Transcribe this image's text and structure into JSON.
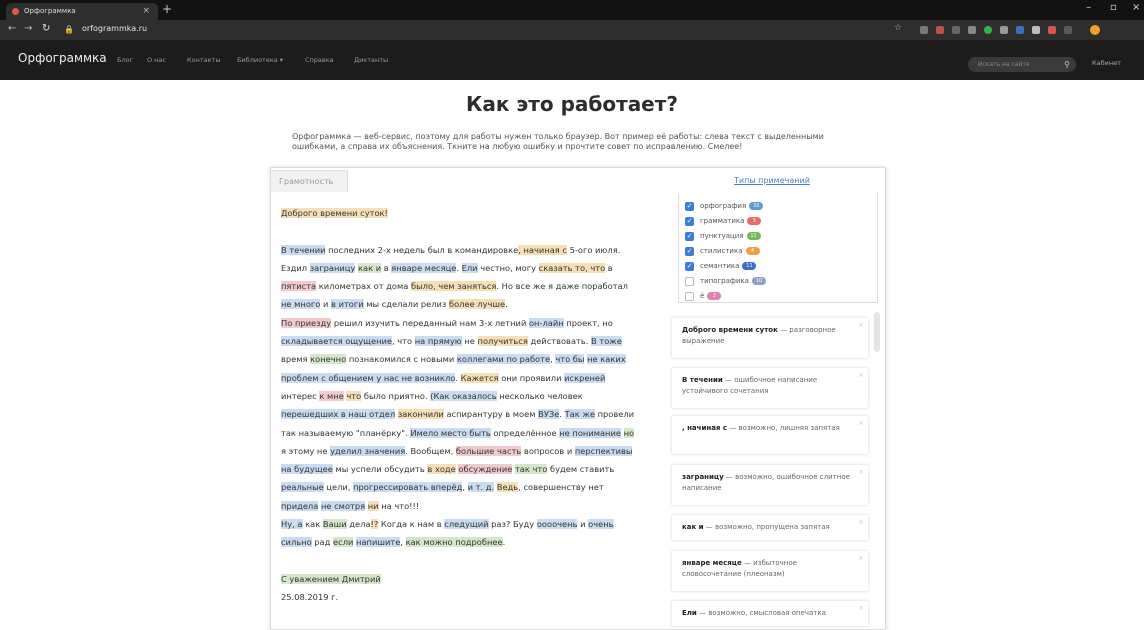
{
  "browser": {
    "tab_title": "Орфограммка",
    "url": "orfogrammka.ru"
  },
  "site": {
    "brand": "Орфограммка",
    "menu": [
      "Блог",
      "О нас",
      "Контакты",
      "Библиотека ▾",
      "Справка",
      "Диктанты"
    ],
    "search_placeholder": "Искать на сайте",
    "cabinet": "Кабинет"
  },
  "page": {
    "title": "Как это работает?",
    "intro": "Орфограммка — веб-сервис, поэтому для работы нужен только браузер. Вот пример её работы: слева текст с выделенными ошибками, а справа их объяснения. Ткните на любую ошибку и прочтите совет по исправлению. Смелее!",
    "tab_label": "Грамотность",
    "types_link": "Типы примечаний"
  },
  "text_lines": [
    [
      [
        "Доброго времени суток!",
        "p"
      ]
    ],
    [],
    [
      [
        "В течении",
        "o"
      ],
      [
        " последних 2-х недель был в командировке",
        ""
      ],
      [
        ", начиная с",
        "p"
      ],
      [
        " 5-ого июля.",
        ""
      ]
    ],
    [
      [
        "Ездил ",
        ""
      ],
      [
        "заграницу",
        "o"
      ],
      [
        " ",
        ""
      ],
      [
        "как и",
        "s"
      ],
      [
        " в ",
        ""
      ],
      [
        "январе месяце",
        "o"
      ],
      [
        ". ",
        ""
      ],
      [
        "Ели",
        "o"
      ],
      [
        " честно, могу ",
        ""
      ],
      [
        "сказать то, что",
        "p"
      ],
      [
        " в",
        ""
      ]
    ],
    [
      [
        "пятиста",
        "g"
      ],
      [
        " километрах от дома ",
        ""
      ],
      [
        "было, чем заняться",
        "p"
      ],
      [
        ". Но все же я даже поработал",
        ""
      ]
    ],
    [
      [
        "не много",
        "o"
      ],
      [
        " и ",
        ""
      ],
      [
        "в итоги",
        "o"
      ],
      [
        " мы сделали релиз ",
        ""
      ],
      [
        "более лучше",
        "p"
      ],
      [
        ".",
        ""
      ]
    ],
    [
      [
        "По приезду",
        "g"
      ],
      [
        " решил изучить переданный нам 3-х летний ",
        ""
      ],
      [
        "он-лайн",
        "o"
      ],
      [
        " проект, но",
        ""
      ]
    ],
    [
      [
        "складывается ощущение",
        "o"
      ],
      [
        ", что ",
        ""
      ],
      [
        "на прямую",
        "o"
      ],
      [
        " не ",
        ""
      ],
      [
        "получиться",
        "p"
      ],
      [
        " действовать. ",
        ""
      ],
      [
        "В тоже",
        "o"
      ]
    ],
    [
      [
        "время ",
        ""
      ],
      [
        "конечно",
        "s"
      ],
      [
        " познакомился с новыми ",
        ""
      ],
      [
        "коллегами по работе",
        "o"
      ],
      [
        ", ",
        ""
      ],
      [
        "что бы",
        "o"
      ],
      [
        " ",
        ""
      ],
      [
        "не каких",
        "o"
      ]
    ],
    [
      [
        "проблем с общением у нас не возникло",
        "o"
      ],
      [
        ". ",
        ""
      ],
      [
        "Кажется",
        "p"
      ],
      [
        " они проявили ",
        ""
      ],
      [
        "искреней",
        "o"
      ]
    ],
    [
      [
        "интерес ",
        ""
      ],
      [
        "к мне",
        "g"
      ],
      [
        " ",
        ""
      ],
      [
        "что",
        "p"
      ],
      [
        " было приятно. ",
        ""
      ],
      [
        "(Как оказалось",
        "o"
      ],
      [
        " несколько человек",
        ""
      ]
    ],
    [
      [
        "перешедших в наш отдел",
        "o"
      ],
      [
        " ",
        ""
      ],
      [
        "закончили",
        "p"
      ],
      [
        " аспирантуру в моем ",
        ""
      ],
      [
        "ВУЗе",
        "o"
      ],
      [
        ". ",
        ""
      ],
      [
        "Так же",
        "o"
      ],
      [
        " провели",
        ""
      ]
    ],
    [
      [
        "так называемую \"планёрку\". ",
        ""
      ],
      [
        "Имело место быть",
        "o"
      ],
      [
        " определённое ",
        ""
      ],
      [
        "не понимание",
        "o"
      ],
      [
        " ",
        ""
      ],
      [
        "но",
        "s"
      ]
    ],
    [
      [
        "я этому не ",
        ""
      ],
      [
        "уделил значения",
        "o"
      ],
      [
        ". Вообщем, ",
        ""
      ],
      [
        "большие часть",
        "g"
      ],
      [
        " вопросов и ",
        ""
      ],
      [
        "перспективы",
        "o"
      ]
    ],
    [
      [
        "на будущее",
        "o"
      ],
      [
        " мы успели обсудить ",
        ""
      ],
      [
        "в ходе",
        "p"
      ],
      [
        " ",
        ""
      ],
      [
        "обсуждение",
        "g"
      ],
      [
        " ",
        ""
      ],
      [
        "так что",
        "s"
      ],
      [
        " будем ставить",
        ""
      ]
    ],
    [
      [
        "реальные",
        "o"
      ],
      [
        " цели, ",
        ""
      ],
      [
        "прогрессировать вперёд",
        "o"
      ],
      [
        ", ",
        ""
      ],
      [
        "и т. д.",
        "o"
      ],
      [
        " ",
        ""
      ],
      [
        "Ведь",
        "p"
      ],
      [
        ", совершенству нет",
        ""
      ]
    ],
    [
      [
        "придела",
        "o"
      ],
      [
        " ",
        ""
      ],
      [
        "не смотря",
        "o"
      ],
      [
        " ",
        ""
      ],
      [
        "ни",
        "p"
      ],
      [
        " на что!!!",
        ""
      ]
    ],
    [
      [
        "Ну, а",
        "o"
      ],
      [
        " как ",
        ""
      ],
      [
        "Ваши",
        "s"
      ],
      [
        " дела",
        ""
      ],
      [
        "!?",
        "p"
      ],
      [
        " Когда к нам в ",
        ""
      ],
      [
        "следущий",
        "o"
      ],
      [
        " раз? Буду ",
        ""
      ],
      [
        "оооочень",
        "o"
      ],
      [
        " и ",
        ""
      ],
      [
        "очень",
        "o"
      ]
    ],
    [
      [
        "сильно",
        "o"
      ],
      [
        " рад ",
        ""
      ],
      [
        "если",
        "s"
      ],
      [
        " ",
        ""
      ],
      [
        "напишите",
        "o"
      ],
      [
        ", ",
        ""
      ],
      [
        "как можно подробнее",
        "s"
      ],
      [
        ".",
        ""
      ]
    ],
    [],
    [
      [
        "С уважением Дмитрий",
        "s"
      ]
    ],
    [
      [
        "25.08.2019 г.",
        ""
      ]
    ]
  ],
  "filters": [
    {
      "label": "орфография",
      "checked": true,
      "count": "33",
      "color": "#5b9bd5"
    },
    {
      "label": "грамматика",
      "checked": true,
      "count": "5",
      "color": "#e06c6c"
    },
    {
      "label": "пунктуация",
      "checked": true,
      "count": "11",
      "color": "#74b85a"
    },
    {
      "label": "стилистика",
      "checked": true,
      "count": "4",
      "color": "#f0a040"
    },
    {
      "label": "семантика",
      "checked": true,
      "count": "11",
      "color": "#3b6fc9"
    },
    {
      "label": "типографика",
      "checked": false,
      "count": "10",
      "color": "#8aa0c8"
    },
    {
      "label": "ё",
      "checked": false,
      "count": "2",
      "color": "#e07fb0"
    }
  ],
  "notes": [
    {
      "head": "Доброго времени суток",
      "body": " — разговорное выражение"
    },
    {
      "head": "В течении",
      "body": " — ошибочное написание устойчивого сочетания"
    },
    {
      "head": ", начиная с",
      "body": " — возможно, лишняя запятая"
    },
    {
      "head": "заграницу",
      "body": " — возможно, ошибочное слитное написание"
    },
    {
      "head": "как и",
      "body": " — возможно, пропущена запятая"
    },
    {
      "head": "январе месяце",
      "body": " — избыточное словосочетание (плеоназм)"
    },
    {
      "head": "Ели",
      "body": " — возможно, смысловая опечатка"
    }
  ],
  "note_close": "×"
}
